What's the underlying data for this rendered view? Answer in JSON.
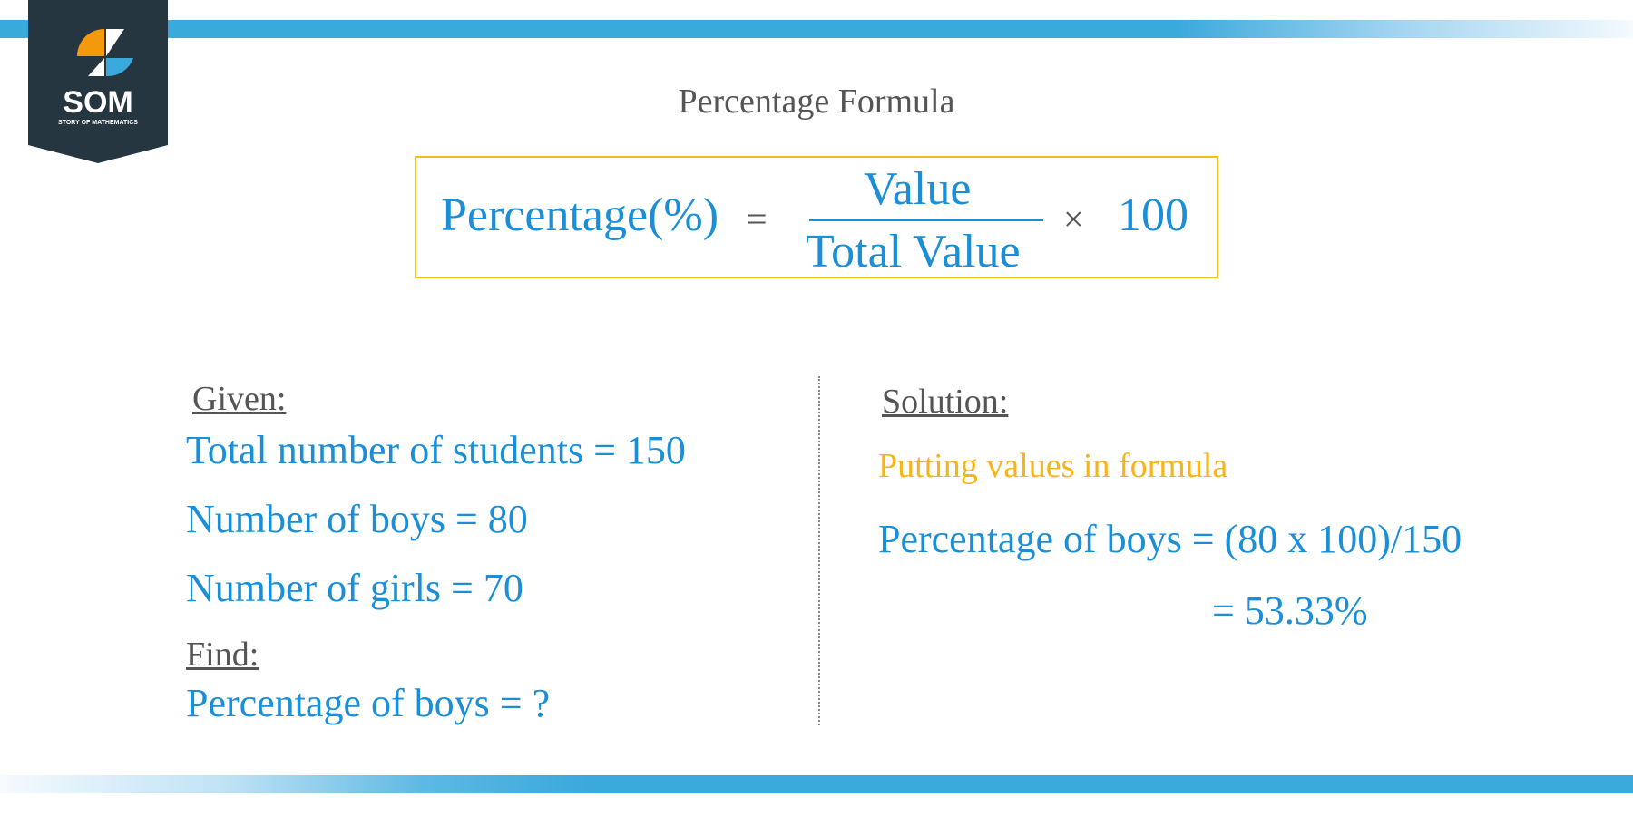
{
  "logo": {
    "name": "SOM",
    "tagline": "STORY OF MATHEMATICS",
    "colors": {
      "badge": "#263641",
      "orange": "#f4990c",
      "blue": "#3aa9dc",
      "white": "#ffffff"
    }
  },
  "title": "Percentage Formula",
  "formula": {
    "lhs": "Percentage(%)",
    "equals": "=",
    "numerator": "Value",
    "denominator": "Total Value",
    "times": "×",
    "multiplier": "100"
  },
  "given": {
    "heading": "Given:",
    "lines": [
      "Total number of students = 150",
      "Number of boys = 80",
      "Number of girls = 70"
    ]
  },
  "find": {
    "heading": "Find:",
    "line": "Percentage of boys = ?"
  },
  "solution": {
    "heading": "Solution:",
    "note": "Putting values in formula",
    "step1": "Percentage of boys = (80 x 100)/150",
    "step2": "= 53.33%"
  },
  "colors": {
    "accent_blue": "#1a8fd8",
    "accent_yellow": "#f7bc1c",
    "heading_gray": "#555555",
    "bar_blue": "#3aa9dc"
  }
}
